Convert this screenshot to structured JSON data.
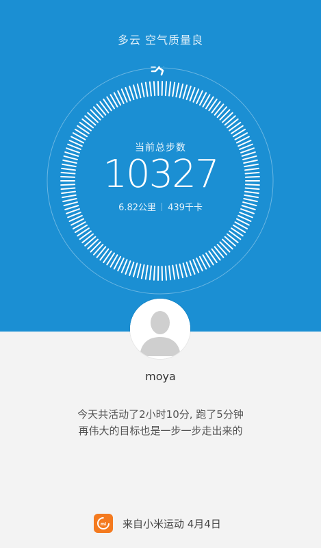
{
  "header": {
    "weather_text": "多云 空气质量良",
    "runner_icon": "running-person-icon"
  },
  "steps": {
    "label": "当前总步数",
    "value": "10327",
    "distance": "6.82公里",
    "calories": "439千卡"
  },
  "profile": {
    "avatar_icon": "default-avatar-icon",
    "username": "moya"
  },
  "message": {
    "line1": "今天共活动了2小时10分, 跑了5分钟",
    "line2": "再伟大的目标也是一步一步走出来的"
  },
  "footer": {
    "app_icon": "mi-fit-app-icon",
    "source_text": "来自小米运动 4月4日"
  },
  "colors": {
    "primary_blue": "#1b8fd3",
    "background": "#f3f3f3",
    "app_orange": "#f47a1f"
  }
}
